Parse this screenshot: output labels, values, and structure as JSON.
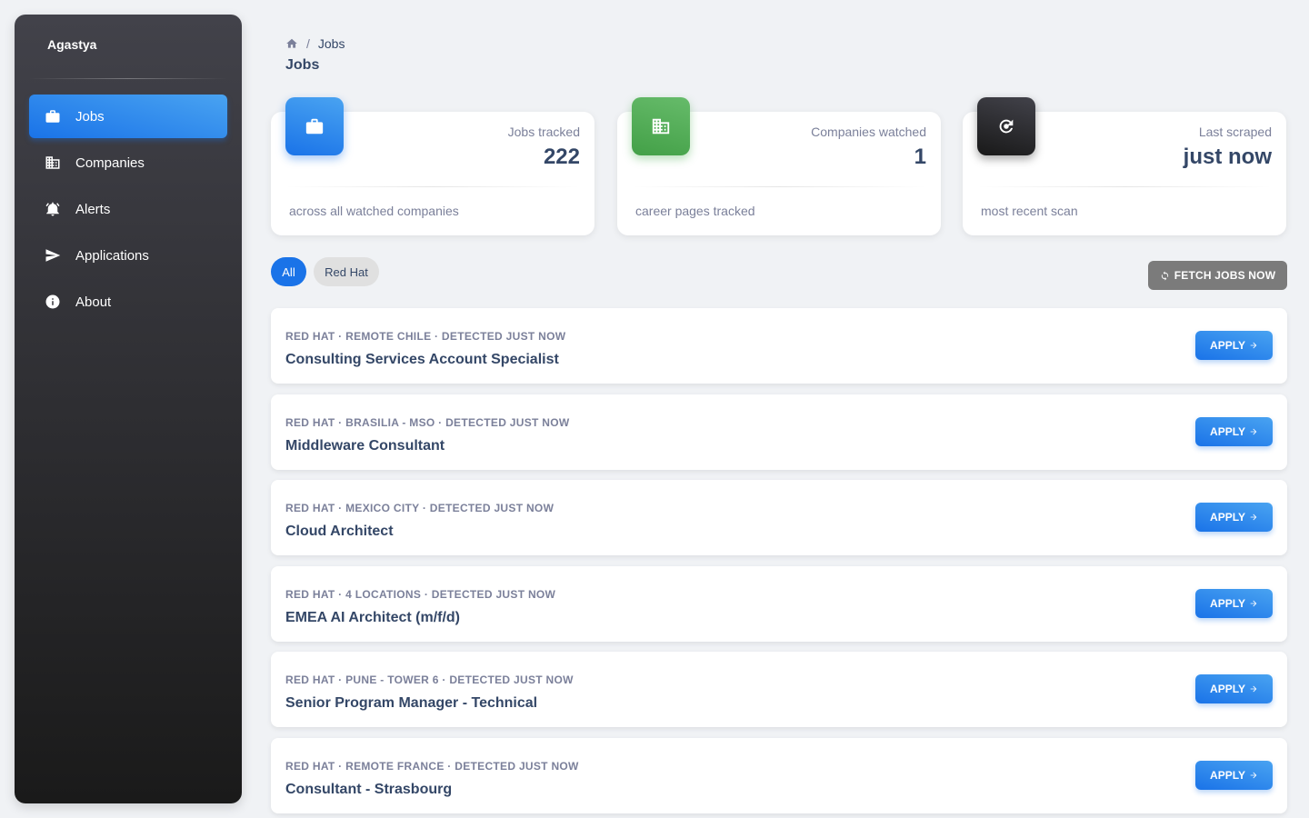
{
  "sidebar": {
    "brand": "Agastya",
    "items": [
      {
        "label": "Jobs",
        "icon": "briefcase-icon"
      },
      {
        "label": "Companies",
        "icon": "building-icon"
      },
      {
        "label": "Alerts",
        "icon": "alarm-icon"
      },
      {
        "label": "Applications",
        "icon": "send-icon"
      },
      {
        "label": "About",
        "icon": "info-icon"
      }
    ]
  },
  "breadcrumb": {
    "current": "Jobs",
    "separator": "/"
  },
  "page_title": "Jobs",
  "stats": [
    {
      "label": "Jobs tracked",
      "value": "222",
      "footer": "across all watched companies",
      "icon": "briefcase-icon",
      "color": "#1a73e8"
    },
    {
      "label": "Companies watched",
      "value": "1",
      "footer": "career pages tracked",
      "icon": "building-icon",
      "color": "#4caf50"
    },
    {
      "label": "Last scraped",
      "value": "just now",
      "footer": "most recent scan",
      "icon": "refresh-icon",
      "color": "#191919"
    }
  ],
  "filters": [
    {
      "label": "All",
      "active": true
    },
    {
      "label": "Red Hat",
      "active": false
    }
  ],
  "fetch_button": {
    "label": "FETCH JOBS NOW",
    "icon": "sync-icon"
  },
  "jobs": [
    {
      "meta": "RED HAT · REMOTE CHILE · DETECTED JUST NOW",
      "title": "Consulting Services Account Specialist",
      "apply": "APPLY"
    },
    {
      "meta": "RED HAT · BRASILIA - MSO · DETECTED JUST NOW",
      "title": "Middleware Consultant",
      "apply": "APPLY"
    },
    {
      "meta": "RED HAT · MEXICO CITY · DETECTED JUST NOW",
      "title": "Cloud Architect",
      "apply": "APPLY"
    },
    {
      "meta": "RED HAT · 4 LOCATIONS · DETECTED JUST NOW",
      "title": "EMEA AI Architect (m/f/d)",
      "apply": "APPLY"
    },
    {
      "meta": "RED HAT · PUNE - TOWER 6 · DETECTED JUST NOW",
      "title": "Senior Program Manager - Technical",
      "apply": "APPLY"
    },
    {
      "meta": "RED HAT · REMOTE FRANCE · DETECTED JUST NOW",
      "title": "Consultant - Strasbourg",
      "apply": "APPLY"
    }
  ],
  "colors": {
    "primary": "#1a73e8",
    "success": "#4caf50",
    "dark": "#191919",
    "background": "#f0f2f5",
    "text": "#344767",
    "muted": "#7b809a"
  }
}
